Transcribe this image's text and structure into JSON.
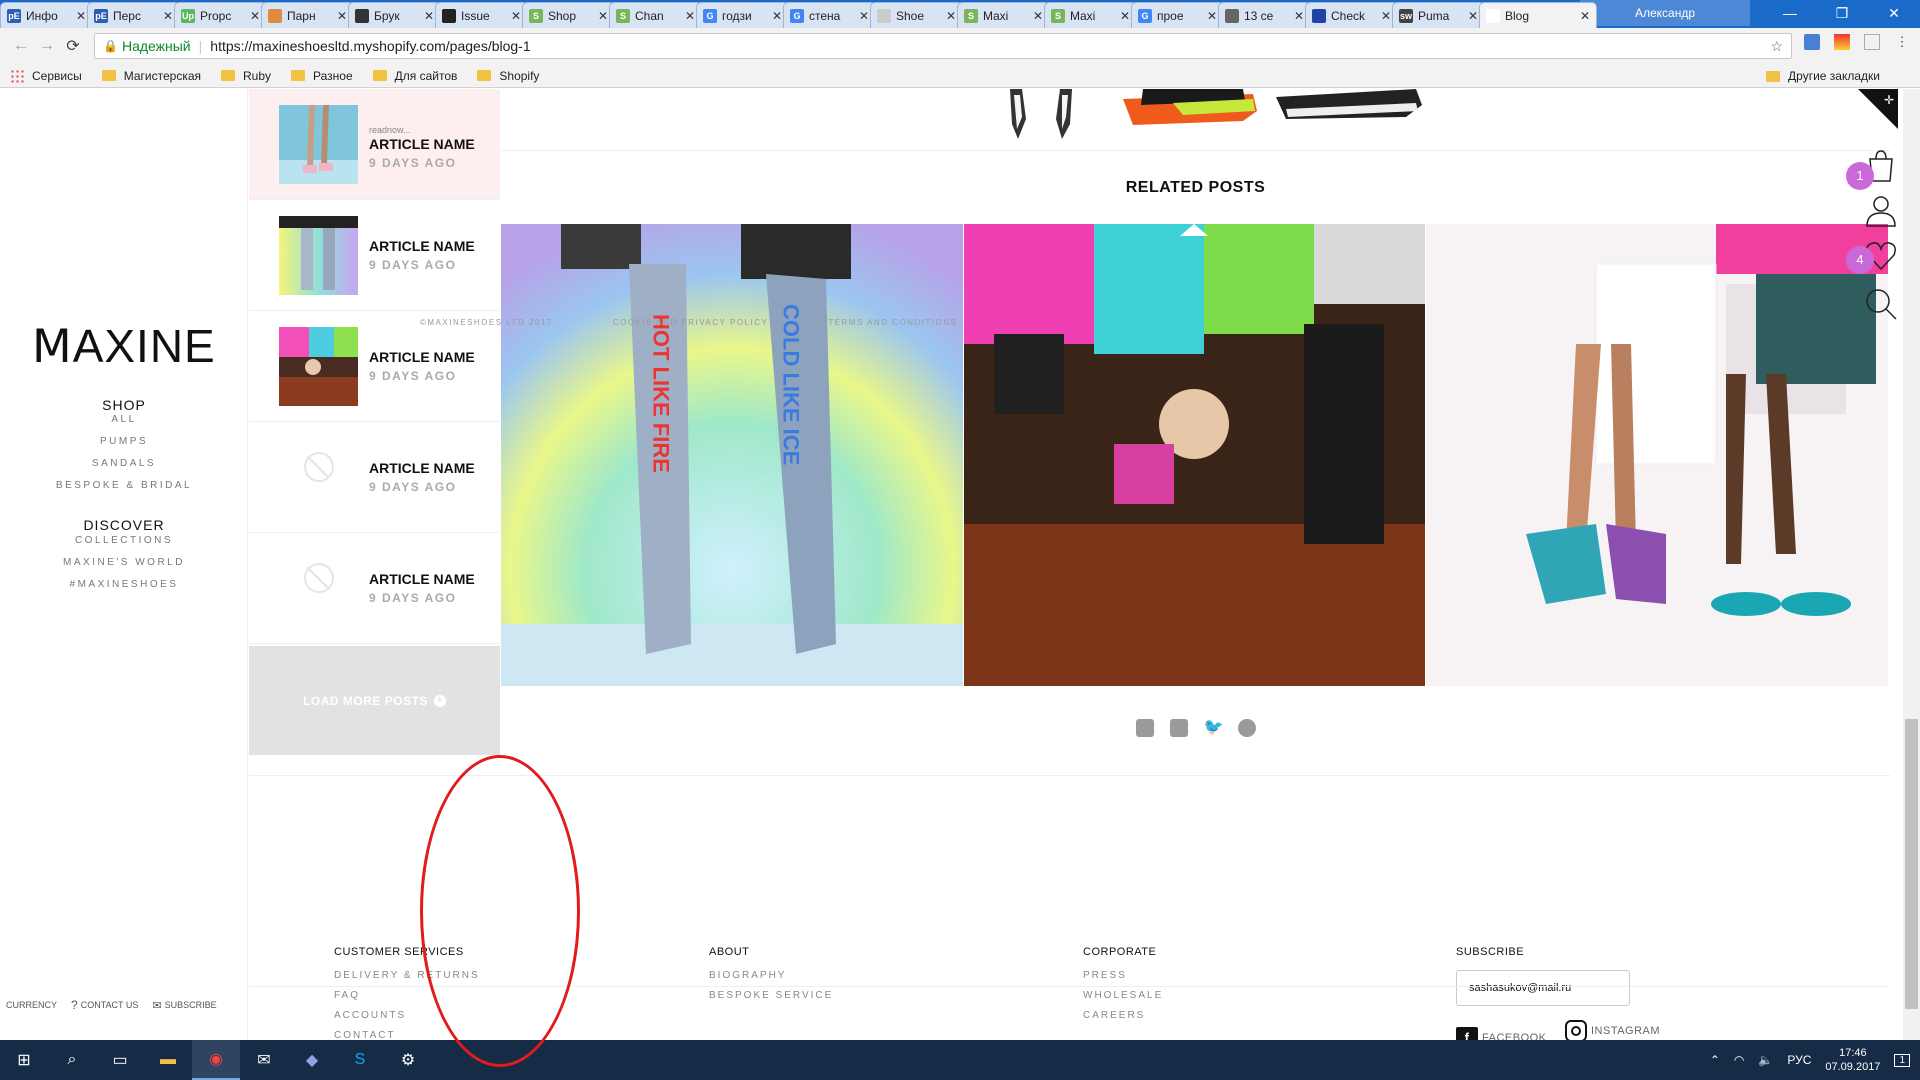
{
  "browser": {
    "tabs": [
      {
        "title": "Инфо",
        "fav": "pE",
        "color": "#2b5fb3"
      },
      {
        "title": "Перс",
        "fav": "pE",
        "color": "#2b5fb3"
      },
      {
        "title": "Propc",
        "fav": "Up",
        "color": "#5cb85c"
      },
      {
        "title": "Парн",
        "fav": "",
        "color": "#e08a3c"
      },
      {
        "title": "Брук",
        "fav": "",
        "color": "#333"
      },
      {
        "title": "Issue",
        "fav": "",
        "color": "#222"
      },
      {
        "title": "Shop",
        "fav": "S",
        "color": "#7ab55c"
      },
      {
        "title": "Chan",
        "fav": "S",
        "color": "#7ab55c"
      },
      {
        "title": "годзи",
        "fav": "G",
        "color": "#4285f4"
      },
      {
        "title": "стена",
        "fav": "G",
        "color": "#4285f4"
      },
      {
        "title": "Shoe",
        "fav": "",
        "color": "#ccc"
      },
      {
        "title": "Maxi",
        "fav": "S",
        "color": "#7ab55c"
      },
      {
        "title": "Maxi",
        "fav": "S",
        "color": "#7ab55c"
      },
      {
        "title": "прое",
        "fav": "G",
        "color": "#4285f4"
      },
      {
        "title": "13 се",
        "fav": "",
        "color": "#666"
      },
      {
        "title": "Check",
        "fav": "",
        "color": "#2244aa"
      },
      {
        "title": "Puma",
        "fav": "sw",
        "color": "#444"
      },
      {
        "title": "Blog",
        "fav": "",
        "color": "#fff"
      }
    ],
    "close_glyph": "✕",
    "profile_name": "Александр",
    "window_controls": [
      "—",
      "❐",
      "✕"
    ],
    "secure_label": "Надежный",
    "url": "https://maxineshoesltd.myshopify.com/pages/blog-1",
    "bookmarks": [
      "Сервисы",
      "Магистерская",
      "Ruby",
      "Разное",
      "Для сайтов",
      "Shopify"
    ],
    "other_bookmarks": "Другие закладки"
  },
  "nav": {
    "logo": "ⅯAXINE",
    "shop_head": "SHOP",
    "shop_items": [
      "ALL",
      "PUMPS",
      "SANDALS",
      "BESPOKE & BRIDAL"
    ],
    "discover_head": "DISCOVER",
    "discover_items": [
      "COLLECTIONS",
      "MAXINE'S WORLD",
      "#MAXINESHOES"
    ],
    "util": {
      "currency": "CURRENCY",
      "contact": "CONTACT US",
      "subscribe": "SUBSCRIBE"
    }
  },
  "articles": {
    "items": [
      {
        "name": "ARTICLE NAME",
        "ago": "9 DAYS AGO",
        "readnow": "readnow...",
        "thumb": "boots"
      },
      {
        "name": "ARTICLE NAME",
        "ago": "9 DAYS AGO",
        "thumb": "legs"
      },
      {
        "name": "ARTICLE NAME",
        "ago": "9 DAYS AGO",
        "thumb": "fur"
      },
      {
        "name": "ARTICLE NAME",
        "ago": "9 DAYS AGO",
        "thumb": "none"
      },
      {
        "name": "ARTICLE NAME",
        "ago": "9 DAYS AGO",
        "thumb": "none"
      }
    ],
    "load_more": "LOAD MORE POSTS",
    "load_more_icon": "+"
  },
  "main": {
    "related_title": "RELATED POSTS"
  },
  "right_icons": {
    "cart_count": "1",
    "wishlist_count": "4"
  },
  "footer": {
    "customer_services": {
      "head": "CUSTOMER SERVICES",
      "items": [
        "DELIVERY & RETURNS",
        "FAQ",
        "ACCOUNTS",
        "CONTACT"
      ]
    },
    "about": {
      "head": "ABOUT",
      "items": [
        "BIOGRAPHY",
        "BESPOKE SERVICE"
      ]
    },
    "corporate": {
      "head": "CORPORATE",
      "items": [
        "PRESS",
        "WHOLESALE",
        "CAREERS"
      ]
    },
    "subscribe": {
      "head": "SUBSCRIBE",
      "email": "sashasukov@mail.ru",
      "facebook": "FACEBOOK",
      "instagram": "INSTAGRAM"
    },
    "legal": [
      "©MAXINESHOES LTD 2017",
      "COOKIE AND PRIVACY POLICY",
      "TERMS AND CONDITIONS"
    ]
  },
  "taskbar": {
    "lang": "РУС",
    "time": "17:46",
    "date": "07.09.2017",
    "notif_count": "1"
  }
}
